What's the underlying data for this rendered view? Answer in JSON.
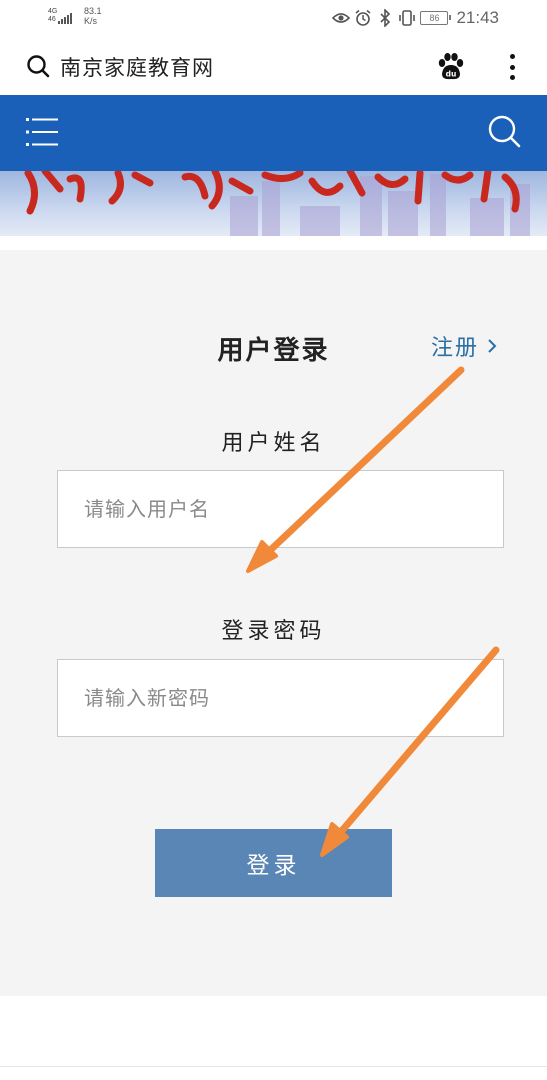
{
  "status_bar": {
    "network_top": "4G",
    "network_bottom": "46",
    "speed_value": "83.1",
    "speed_unit": "K/s",
    "battery_level": "86",
    "time": "21:43"
  },
  "browser": {
    "title": "南京家庭教育网"
  },
  "site": {
    "nav_color": "#1a5fb8"
  },
  "login": {
    "title": "用户登录",
    "register_label": "注册",
    "username_label": "用户姓名",
    "username_placeholder": "请输入用户名",
    "password_label": "登录密码",
    "password_placeholder": "请输入新密码",
    "submit_label": "登录",
    "button_color": "#5a86b5"
  },
  "annotation": {
    "arrow_color": "#f08a3a"
  }
}
